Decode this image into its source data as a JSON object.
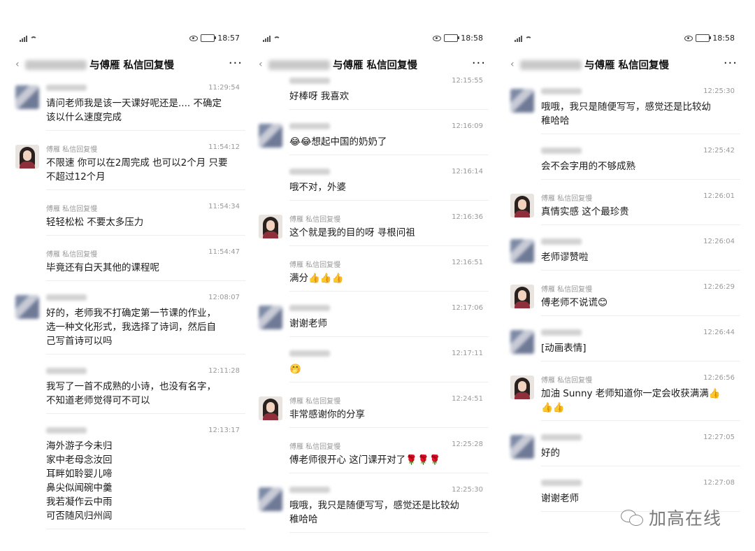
{
  "phones": [
    {
      "status_time": "18:57",
      "title": "与傅雁 私信回复慢",
      "messages": [
        {
          "sender": "",
          "time": "11:29:54",
          "avatar": "blurred",
          "text": "请问老师我是该一天课好呢还是.... 不确定\n该以什么速度完成"
        },
        {
          "sender": "傅雁 私信回复慢",
          "time": "11:54:12",
          "avatar": "teacher",
          "text": "不限速 你可以在2周完成 也可以2个月 只要\n不超过12个月"
        },
        {
          "sender": "傅雁 私信回复慢",
          "time": "11:54:34",
          "avatar": "none",
          "text": "轻轻松松 不要太多压力"
        },
        {
          "sender": "傅雁 私信回复慢",
          "time": "11:54:47",
          "avatar": "none",
          "text": "毕竟还有白天其他的课程呢"
        },
        {
          "sender": "",
          "time": "12:08:07",
          "avatar": "blurred",
          "text": "好的，老师我不打确定第一节课的作业，\n选一种文化形式，我选择了诗词，然后自\n己写首诗可以吗"
        },
        {
          "sender": "",
          "time": "12:11:28",
          "avatar": "none",
          "text": "我写了一首不成熟的小诗，也没有名字，\n不知道老师觉得可不可以"
        },
        {
          "sender": "",
          "time": "12:13:17",
          "avatar": "none",
          "text": "海外游子今未归\n家中老母念汝回\n耳畔如聆婴儿啼\n鼻尖似闻碗中羹\n我若凝作云中雨\n可否随风归州闾"
        }
      ]
    },
    {
      "status_time": "18:58",
      "title": "与傅雁 私信回复慢",
      "messages": [
        {
          "sender": "",
          "time": "12:15:55",
          "avatar": "none",
          "text": "好棒呀 我喜欢"
        },
        {
          "sender": "",
          "time": "12:16:09",
          "avatar": "blurred",
          "text": "😂😂想起中国的奶奶了"
        },
        {
          "sender": "",
          "time": "12:16:14",
          "avatar": "none",
          "text": "哦不对，外婆"
        },
        {
          "sender": "傅雁 私信回复慢",
          "time": "12:16:36",
          "avatar": "teacher",
          "text": "这个就是我的目的呀 寻根问祖"
        },
        {
          "sender": "傅雁 私信回复慢",
          "time": "12:16:51",
          "avatar": "none",
          "text": "满分👍👍👍"
        },
        {
          "sender": "",
          "time": "12:17:06",
          "avatar": "blurred",
          "text": "谢谢老师"
        },
        {
          "sender": "",
          "time": "12:17:11",
          "avatar": "none",
          "text": "🤭"
        },
        {
          "sender": "傅雁 私信回复慢",
          "time": "12:24:51",
          "avatar": "teacher",
          "text": "非常感谢你的分享"
        },
        {
          "sender": "傅雁 私信回复慢",
          "time": "12:25:28",
          "avatar": "none",
          "text": "傅老师很开心 这门课开对了🌹🌹🌹"
        },
        {
          "sender": "",
          "time": "12:25:30",
          "avatar": "blurred",
          "text": "哦哦，我只是随便写写，感觉还是比较幼\n稚哈哈"
        }
      ]
    },
    {
      "status_time": "18:58",
      "title": "与傅雁 私信回复慢",
      "messages": [
        {
          "sender": "",
          "time": "12:25:30",
          "avatar": "blurred",
          "text": "哦哦，我只是随便写写，感觉还是比较幼\n稚哈哈"
        },
        {
          "sender": "",
          "time": "12:25:42",
          "avatar": "none",
          "text": "会不会字用的不够成熟"
        },
        {
          "sender": "傅雁 私信回复慢",
          "time": "12:26:01",
          "avatar": "teacher",
          "text": "真情实感 这个最珍贵"
        },
        {
          "sender": "",
          "time": "12:26:04",
          "avatar": "blurred",
          "text": "老师谬赞啦"
        },
        {
          "sender": "傅雁 私信回复慢",
          "time": "12:26:29",
          "avatar": "teacher",
          "text": "傅老师不说谎😊"
        },
        {
          "sender": "",
          "time": "12:26:44",
          "avatar": "blurred",
          "text": "[动画表情]"
        },
        {
          "sender": "傅雁 私信回复慢",
          "time": "12:26:56",
          "avatar": "teacher",
          "text": "加油 Sunny 老师知道你一定会收获满满👍\n👍👍"
        },
        {
          "sender": "",
          "time": "12:27:05",
          "avatar": "blurred",
          "text": "好的"
        },
        {
          "sender": "",
          "time": "12:27:08",
          "avatar": "none",
          "text": "谢谢老师"
        }
      ]
    }
  ],
  "watermark": {
    "text": "加高在线",
    "icon": "wechat-icon"
  },
  "colors": {
    "text": "#1a1a1a",
    "meta": "#999999",
    "divider": "#eeeeee"
  }
}
